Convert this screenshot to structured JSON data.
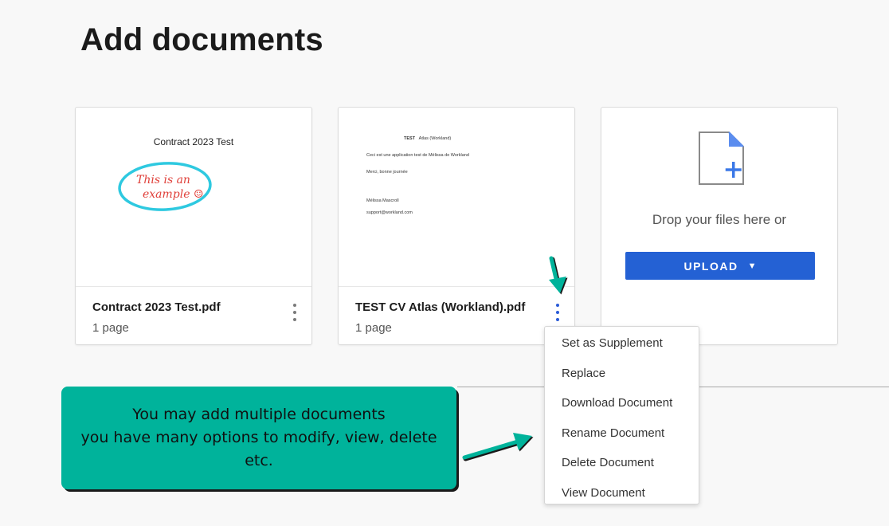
{
  "page": {
    "title": "Add documents"
  },
  "documents": [
    {
      "file_name": "Contract 2023 Test.pdf",
      "pages": "1 page",
      "preview": {
        "heading": "Contract 2023 Test",
        "handwriting_line1": "This is an",
        "handwriting_line2": "example ☺"
      }
    },
    {
      "file_name": "TEST CV Atlas (Workland).pdf",
      "pages": "1 page",
      "preview": {
        "heading_bold": "TEST",
        "heading_rest": "Atlas (Workland)",
        "lines": [
          "Ceci est une application test de Mélissa de Workland",
          "Merci, bonne journée",
          "Mélissa Mascroll",
          "support@workland.com"
        ]
      }
    }
  ],
  "upload": {
    "drop_text": "Drop your files here or",
    "button_label": "UPLOAD",
    "caret": "▼"
  },
  "context_menu": {
    "items": [
      "Set as Supplement",
      "Replace",
      "Download Document",
      "Rename Document",
      "Delete Document",
      "View Document"
    ]
  },
  "callout": {
    "line1": "You may add multiple documents",
    "line2": "you have many options to modify, view, delete",
    "line3": "etc."
  },
  "colors": {
    "accent": "#2461d4",
    "callout": "#00b39b",
    "circle": "#2ec9e0",
    "handwriting": "#e0403a"
  },
  "icons": {
    "file_add": "file-plus-icon",
    "menu": "more-vert-icon"
  }
}
